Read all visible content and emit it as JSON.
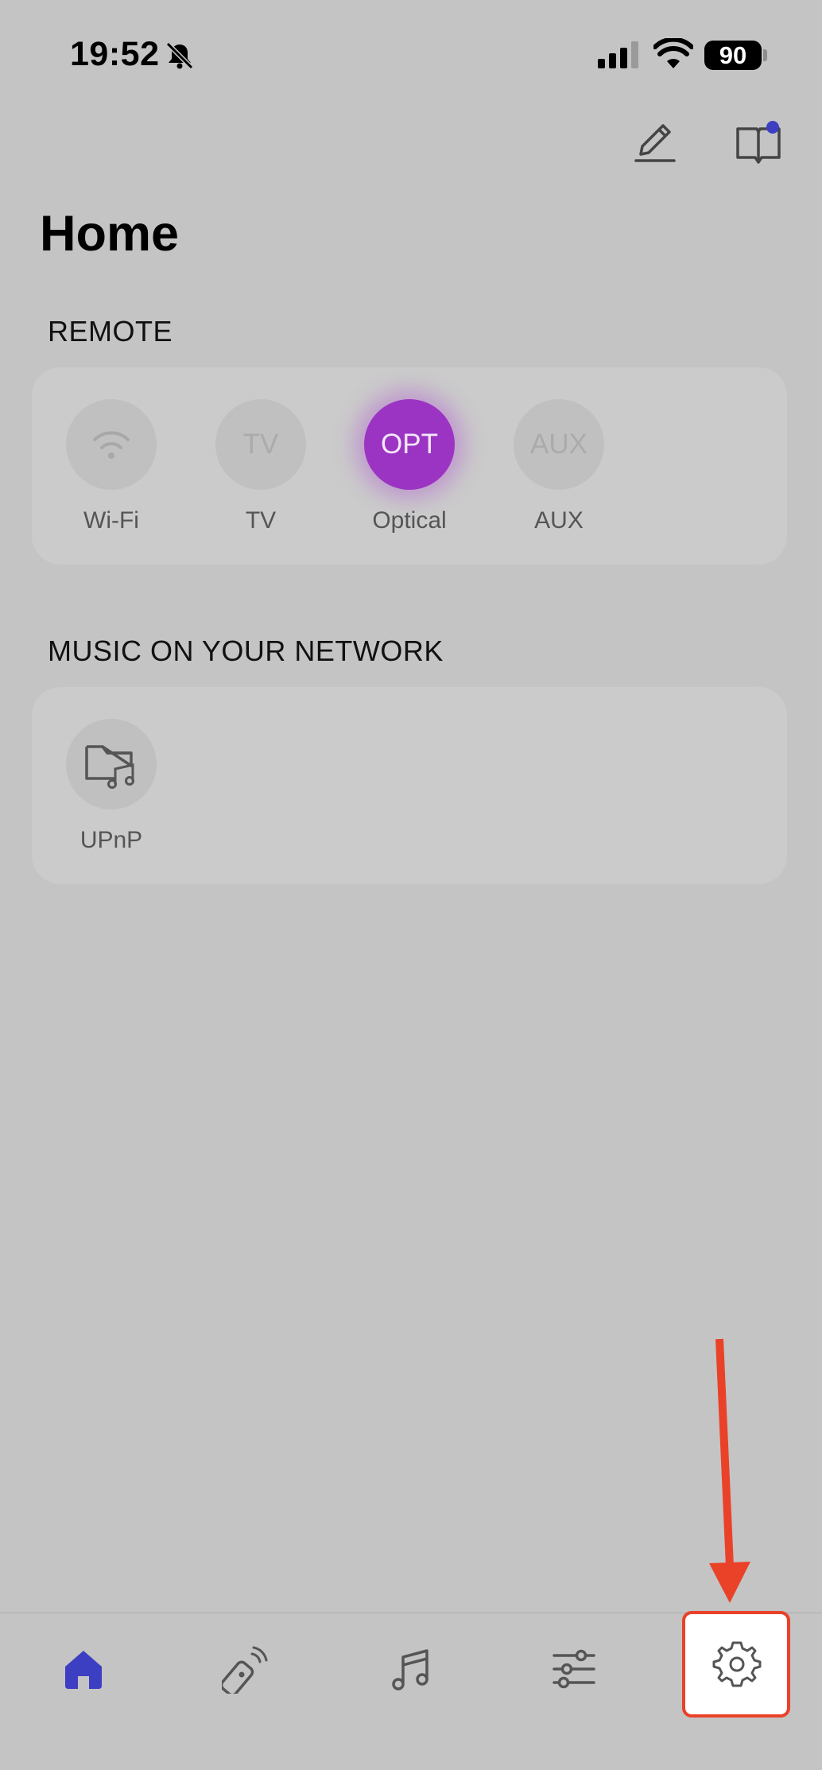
{
  "status_bar": {
    "time": "19:52",
    "battery": "90"
  },
  "page": {
    "title": "Home"
  },
  "remote": {
    "title": "REMOTE",
    "sources": [
      {
        "label": "Wi-Fi",
        "icon": "wifi-icon",
        "active": false
      },
      {
        "label": "TV",
        "badge": "TV",
        "active": false
      },
      {
        "label": "Optical",
        "badge": "OPT",
        "active": true
      },
      {
        "label": "AUX",
        "badge": "AUX",
        "active": false
      }
    ]
  },
  "music": {
    "title": "MUSIC ON YOUR NETWORK",
    "items": [
      {
        "label": "UPnP",
        "icon": "folder-music-icon"
      }
    ]
  },
  "tab_bar": {
    "tabs": [
      {
        "name": "home",
        "icon": "home-icon",
        "active": true
      },
      {
        "name": "remote",
        "icon": "remote-icon",
        "active": false
      },
      {
        "name": "music",
        "icon": "music-note-icon",
        "active": false
      },
      {
        "name": "equalizer",
        "icon": "sliders-icon",
        "active": false
      },
      {
        "name": "settings",
        "icon": "gear-icon",
        "active": false,
        "highlighted": true
      }
    ]
  },
  "colors": {
    "accent": "#3c3fc2",
    "active_source": "#9b34c3",
    "annotation": "#e94228",
    "background": "#c4c4c4"
  }
}
